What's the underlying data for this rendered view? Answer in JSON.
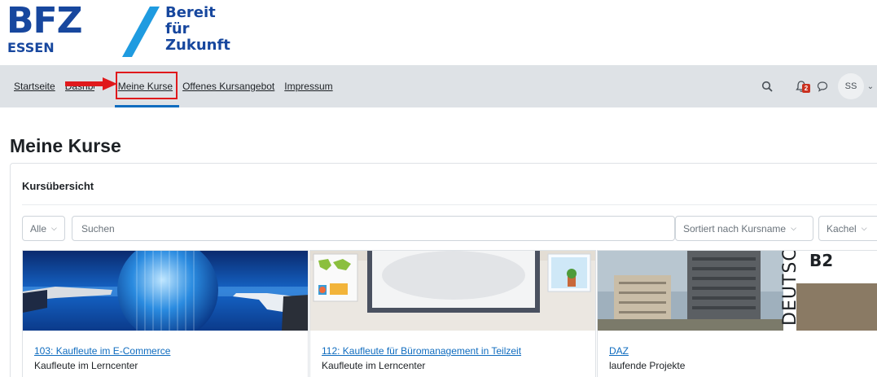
{
  "logo": {
    "brand": "BFZ",
    "location": "ESSEN",
    "claim": [
      "Bereit",
      "für",
      "Zukunft"
    ],
    "brand_color": "#17479e",
    "accent_color": "#1f9be0"
  },
  "nav": {
    "items": [
      {
        "label": "Startseite"
      },
      {
        "label": "Dashboard"
      },
      {
        "label": "Meine Kurse",
        "active": true
      },
      {
        "label": "Offenes Kursangebot"
      },
      {
        "label": "Impressum"
      }
    ],
    "search_icon": "search-icon",
    "notifications": {
      "icon": "bell-icon",
      "count": "2"
    },
    "messages_icon": "chat-icon",
    "user_initials": "SS",
    "highlight_color": "#e0191c"
  },
  "page": {
    "title": "Meine Kurse"
  },
  "overview": {
    "title": "Kursübersicht",
    "filter": {
      "label": "Alle"
    },
    "search": {
      "placeholder": "Suchen"
    },
    "sort": {
      "label": "Sortiert nach Kursname"
    },
    "view": {
      "label": "Kachel"
    },
    "courses": [
      {
        "name": "103: Kaufleute im E-Commerce",
        "category": "Kaufleute im Lerncenter",
        "image": "digital-globe-hands"
      },
      {
        "name": "112: Kaufleute für Büromanagement in Teilzeit",
        "category": "Kaufleute im Lerncenter",
        "image": "classroom-whiteboard"
      },
      {
        "name": "DAZ",
        "category": "laufende Projekte",
        "image": "city-buildings-deutsch-b2",
        "image_text": [
          "DEUTSCH",
          "B2"
        ]
      }
    ]
  }
}
